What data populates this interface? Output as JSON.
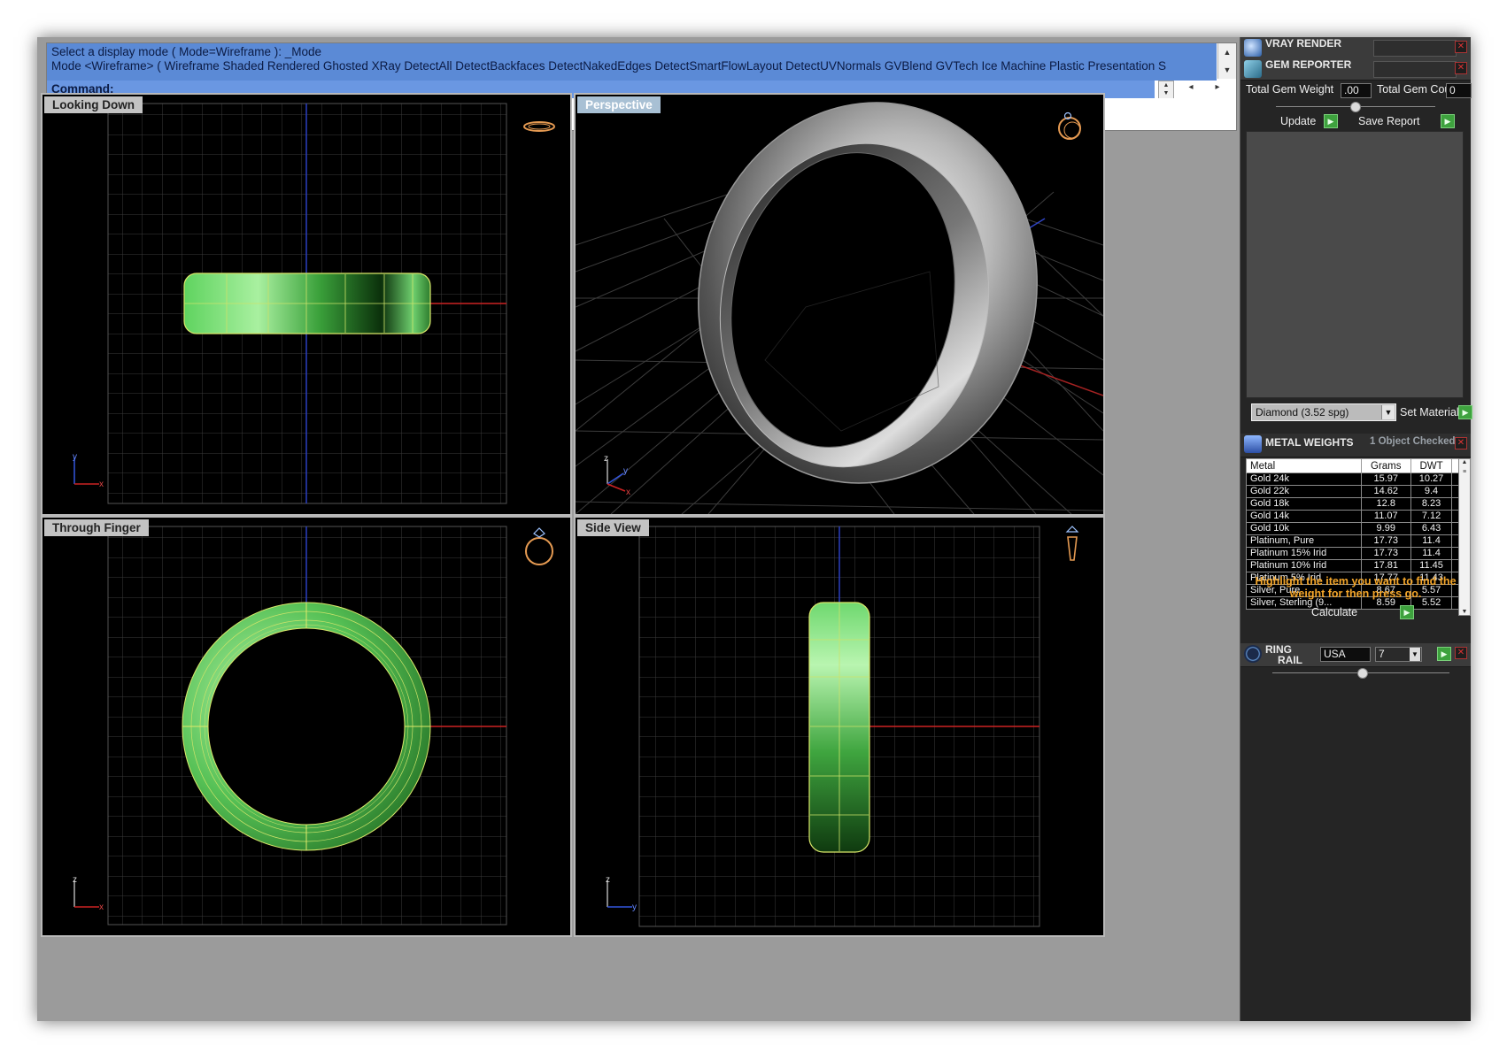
{
  "command_area": {
    "history_line1": "Select a display mode ( Mode=Wireframe ): _Mode",
    "history_line2": "Mode <Wireframe> ( Wireframe  Shaded  Rendered  Ghosted  XRay  DetectAll  DetectBackfaces  DetectNakedEdges  DetectSmartFlowLayout  DetectUVNormals  GVBlend  GVTech  Ice  Machine  Plastic  Presentation  S",
    "prompt": "Command:"
  },
  "viewports": {
    "top_left": {
      "title": "Looking Down",
      "axis1": "y",
      "axis2": "x"
    },
    "top_right": {
      "title": "Perspective",
      "axis1": "z",
      "axis2": "y",
      "axis3": "x"
    },
    "bottom_left": {
      "title": "Through Finger",
      "axis1": "z",
      "axis2": "x"
    },
    "bottom_right": {
      "title": "Side View",
      "axis1": "z",
      "axis2": "y"
    }
  },
  "panel": {
    "vray": {
      "title": "VRAY RENDER"
    },
    "gem_reporter": {
      "title": "GEM REPORTER",
      "total_weight_label": "Total Gem Weight",
      "total_weight_value": ".00",
      "total_count_label": "Total Gem Count",
      "total_count_value": "0",
      "update_label": "Update",
      "save_report_label": "Save Report",
      "material_value": "Diamond    (3.52 spg)",
      "set_material_label": "Set Material"
    },
    "metal_weights": {
      "title": "METAL WEIGHTS",
      "status": "1 Object Checked",
      "columns": [
        "Metal",
        "Grams",
        "DWT"
      ],
      "rows": [
        [
          "Gold 24k",
          "15.97",
          "10.27"
        ],
        [
          "Gold 22k",
          "14.62",
          "9.4"
        ],
        [
          "Gold 18k",
          "12.8",
          "8.23"
        ],
        [
          "Gold 14k",
          "11.07",
          "7.12"
        ],
        [
          "Gold 10k",
          "9.99",
          "6.43"
        ],
        [
          "Platinum, Pure",
          "17.73",
          "11.4"
        ],
        [
          "Platinum 15% Irid",
          "17.73",
          "11.4"
        ],
        [
          "Platinum 10% Irid",
          "17.81",
          "11.45"
        ],
        [
          "Platinum 5% Irid",
          "17.77",
          "11.43"
        ],
        [
          "Silver, Pure",
          "8.67",
          "5.57"
        ],
        [
          "Silver, Sterling (9...",
          "8.59",
          "5.52"
        ]
      ],
      "hint": "Highlight the item you want to find the weight for then press go.",
      "calculate_label": "Calculate"
    },
    "ring_rail": {
      "title_line1": "RING",
      "title_line2": "RAIL",
      "standard": "USA",
      "size": "7"
    }
  }
}
